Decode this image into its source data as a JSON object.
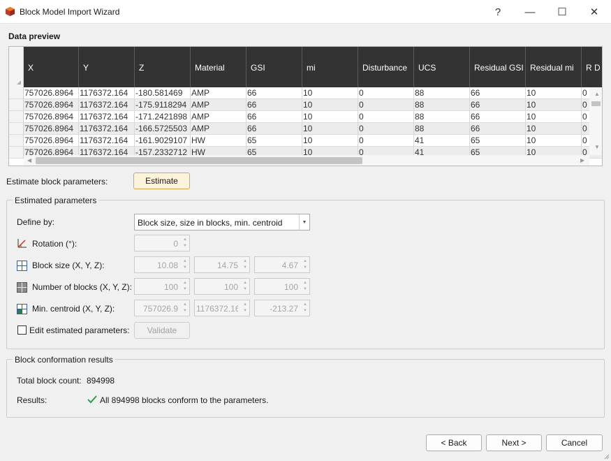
{
  "window": {
    "title": "Block Model Import Wizard",
    "help_glyph": "?",
    "minimize_glyph": "—",
    "maximize_glyph": "☐",
    "close_glyph": "✕"
  },
  "data_preview": {
    "title": "Data preview",
    "columns": [
      "X",
      "Y",
      "Z",
      "Material",
      "GSI",
      "mi",
      "Disturbance",
      "UCS",
      "Residual GSI",
      "Residual mi",
      "R D"
    ],
    "rows": [
      [
        "757026.8964",
        "1176372.164",
        "-180.581469",
        "AMP",
        "66",
        "10",
        "0",
        "88",
        "66",
        "10",
        "0"
      ],
      [
        "757026.8964",
        "1176372.164",
        "-175.9118294",
        "AMP",
        "66",
        "10",
        "0",
        "88",
        "66",
        "10",
        "0"
      ],
      [
        "757026.8964",
        "1176372.164",
        "-171.2421898",
        "AMP",
        "66",
        "10",
        "0",
        "88",
        "66",
        "10",
        "0"
      ],
      [
        "757026.8964",
        "1176372.164",
        "-166.5725503",
        "AMP",
        "66",
        "10",
        "0",
        "88",
        "66",
        "10",
        "0"
      ],
      [
        "757026.8964",
        "1176372.164",
        "-161.9029107",
        "HW",
        "65",
        "10",
        "0",
        "41",
        "65",
        "10",
        "0"
      ],
      [
        "757026.8964",
        "1176372.164",
        "-157.2332712",
        "HW",
        "65",
        "10",
        "0",
        "41",
        "65",
        "10",
        "0"
      ]
    ]
  },
  "estimate": {
    "label": "Estimate block parameters:",
    "button": "Estimate"
  },
  "estimated": {
    "title": "Estimated parameters",
    "define_by_label": "Define by:",
    "define_by_value": "Block size, size in blocks, min. centroid",
    "rotation_label": "Rotation (°):",
    "rotation_value": "0",
    "block_size_label": "Block size (X, Y, Z):",
    "block_size": [
      "10.08",
      "14.75",
      "4.67"
    ],
    "num_blocks_label": "Number of blocks (X, Y, Z):",
    "num_blocks": [
      "100",
      "100",
      "100"
    ],
    "min_centroid_label": "Min. centroid (X, Y, Z):",
    "min_centroid": [
      "757026.9",
      "1176372.16",
      "-213.27"
    ],
    "edit_label": "Edit estimated parameters:",
    "validate_button": "Validate"
  },
  "conformation": {
    "title": "Block conformation results",
    "total_label": "Total block count:",
    "total_value": "894998",
    "results_label": "Results:",
    "results_text": "All 894998 blocks conform to the parameters."
  },
  "footer": {
    "back": "< Back",
    "next": "Next >",
    "cancel": "Cancel"
  },
  "colors": {
    "header_bg": "#333333",
    "estimate_btn_bg": "#fdf3dc",
    "estimate_btn_border": "#d7a74d",
    "check_green": "#2e9e3e"
  }
}
